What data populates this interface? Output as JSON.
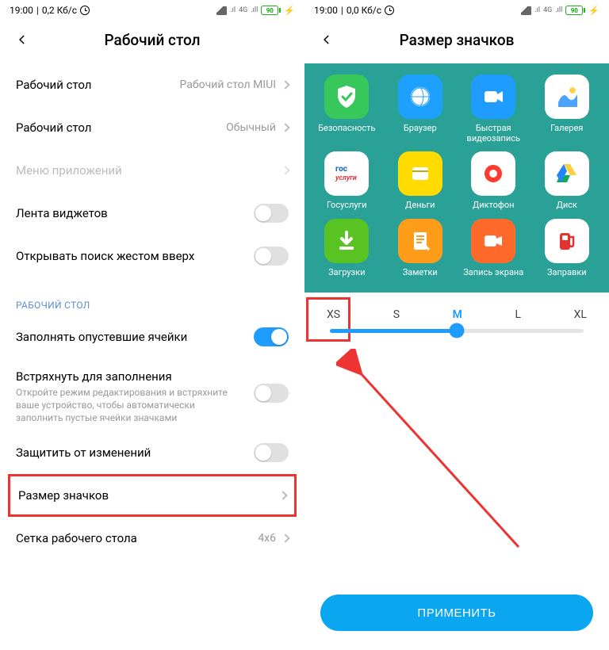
{
  "left": {
    "status": {
      "time": "19:00",
      "net": "0,2 Кб/с",
      "sig4g": "4G",
      "batt": "90"
    },
    "title": "Рабочий стол",
    "rows": [
      {
        "label": "Рабочий стол",
        "value": "Рабочий стол MIUI",
        "type": "nav"
      },
      {
        "label": "Рабочий стол",
        "value": "Обычный",
        "type": "nav"
      },
      {
        "label": "Меню приложений",
        "type": "nav",
        "disabled": true
      },
      {
        "label": "Лента виджетов",
        "type": "toggle",
        "on": false
      },
      {
        "label": "Открывать поиск жестом вверх",
        "type": "toggle",
        "on": false
      }
    ],
    "section": "РАБОЧИЙ СТОЛ",
    "rows2": [
      {
        "label": "Заполнять опустевшие ячейки",
        "type": "toggle",
        "on": true
      },
      {
        "label": "Встряхнуть для заполнения",
        "sub": "Откройте режим редактирования и встряхните ваше устройство, чтобы автоматически заполнить пустые ячейки значками",
        "type": "toggle",
        "on": false
      },
      {
        "label": "Защитить от изменений",
        "type": "toggle",
        "on": false
      },
      {
        "label": "Размер значков",
        "type": "nav",
        "highlight": true
      },
      {
        "label": "Сетка рабочего стола",
        "value": "4x6",
        "type": "nav"
      }
    ]
  },
  "right": {
    "status": {
      "time": "19:00",
      "net": "0,0 Кб/с",
      "sig4g": "4G",
      "batt": "90"
    },
    "title": "Размер значков",
    "apps": [
      {
        "label": "Безопасность",
        "bg": "#37c75b",
        "glyph": "shield"
      },
      {
        "label": "Браузер",
        "bg": "#1ea0ff",
        "glyph": "globe"
      },
      {
        "label": "Быстрая видеозапись",
        "bg": "#1e9cff",
        "glyph": "camcorder"
      },
      {
        "label": "Галерея",
        "bg": "#ffffff",
        "glyph": "gallery"
      },
      {
        "label": "Госуслуги",
        "bg": "#ffffff",
        "glyph": "gos"
      },
      {
        "label": "Деньги",
        "bg": "#ffdb00",
        "glyph": "wallet"
      },
      {
        "label": "Диктофон",
        "bg": "#ffffff",
        "glyph": "rec"
      },
      {
        "label": "Диск",
        "bg": "#ffffff",
        "glyph": "drive"
      },
      {
        "label": "Загрузки",
        "bg": "#58c322",
        "glyph": "download"
      },
      {
        "label": "Заметки",
        "bg": "#ff9c1a",
        "glyph": "note"
      },
      {
        "label": "Запись экрана",
        "bg": "#ff6a2b",
        "glyph": "screenrec"
      },
      {
        "label": "Заправки",
        "bg": "#ffffff",
        "glyph": "fuel"
      }
    ],
    "sizes": {
      "options": [
        "XS",
        "S",
        "M",
        "L",
        "XL"
      ],
      "selected": "M",
      "highlight": "XS"
    },
    "apply": "ПРИМЕНИТЬ"
  }
}
